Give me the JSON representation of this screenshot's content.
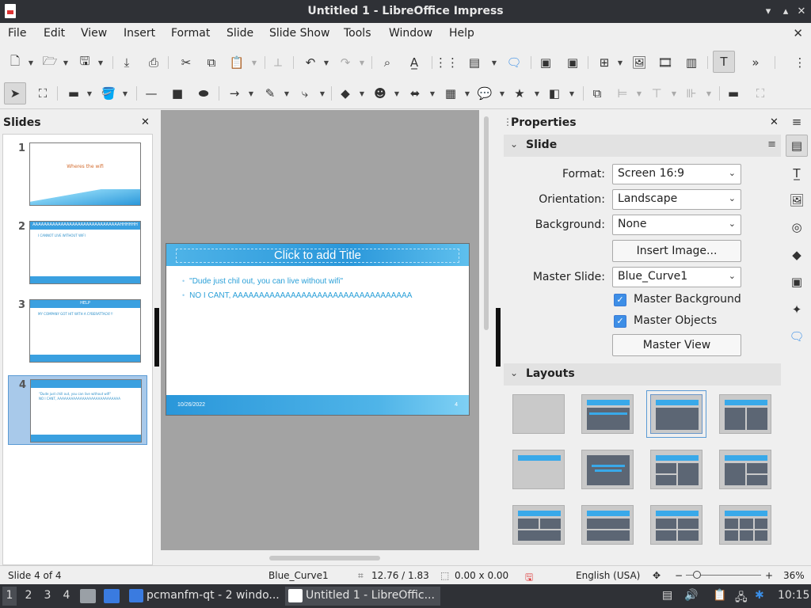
{
  "titlebar": {
    "title": "Untitled 1 - LibreOffice Impress",
    "min": "▾",
    "max": "▴",
    "close": "✕"
  },
  "menubar": {
    "items": [
      "File",
      "Edit",
      "View",
      "Insert",
      "Format",
      "Slide",
      "Slide Show",
      "Tools",
      "Window",
      "Help"
    ],
    "close": "✕"
  },
  "slides_panel": {
    "heading": "Slides",
    "close": "✕",
    "slides": [
      {
        "num": "1",
        "title": "Wheres the wifi",
        "body": ""
      },
      {
        "num": "2",
        "title": "AAAAAAAAAAAAAAAAAAAAAAAAAAAAAAAHHHHHH",
        "body": "I CANNOT LIVE WITHOUT WIFI"
      },
      {
        "num": "3",
        "title": "HELP",
        "body": "MY COMPANY GOT HIT WITH A CYBERATTACK!!!"
      },
      {
        "num": "4",
        "title": "",
        "body": "\"Dude just chill out, you can live without wifi\"",
        "body2": "NO I CANT, AAAAAAAAAAAAAAAAAAAAAAAAAAAA"
      }
    ]
  },
  "slide": {
    "title_placeholder": "Click to add Title",
    "bullets": [
      "\"Dude just chil out, you can live without wifi\"",
      "NO I CANT, AAAAAAAAAAAAAAAAAAAAAAAAAAAAAAAAAA"
    ],
    "date": "10/26/2022",
    "page_number": "4"
  },
  "properties": {
    "heading": "Properties",
    "close": "✕",
    "slide_section": "Slide",
    "format_label": "Format:",
    "format_value": "Screen 16:9",
    "orientation_label": "Orientation:",
    "orientation_value": "Landscape",
    "background_label": "Background:",
    "background_value": "None",
    "insert_image": "Insert Image...",
    "master_slide_label": "Master Slide:",
    "master_slide_value": "Blue_Curve1",
    "master_background": "Master Background",
    "master_objects": "Master Objects",
    "master_view": "Master View",
    "layouts_section": "Layouts"
  },
  "status": {
    "slide_info": "Slide 4 of 4",
    "master": "Blue_Curve1",
    "position": "12.76 / 1.83",
    "size": "0.00 x 0.00",
    "language": "English (USA)",
    "zoom": "36%"
  },
  "taskbar": {
    "workspaces": [
      "1",
      "2",
      "3",
      "4"
    ],
    "task1": "pcmanfm-qt - 2 windo...",
    "task2": "Untitled 1 - LibreOffic...",
    "clock": "10:15"
  }
}
